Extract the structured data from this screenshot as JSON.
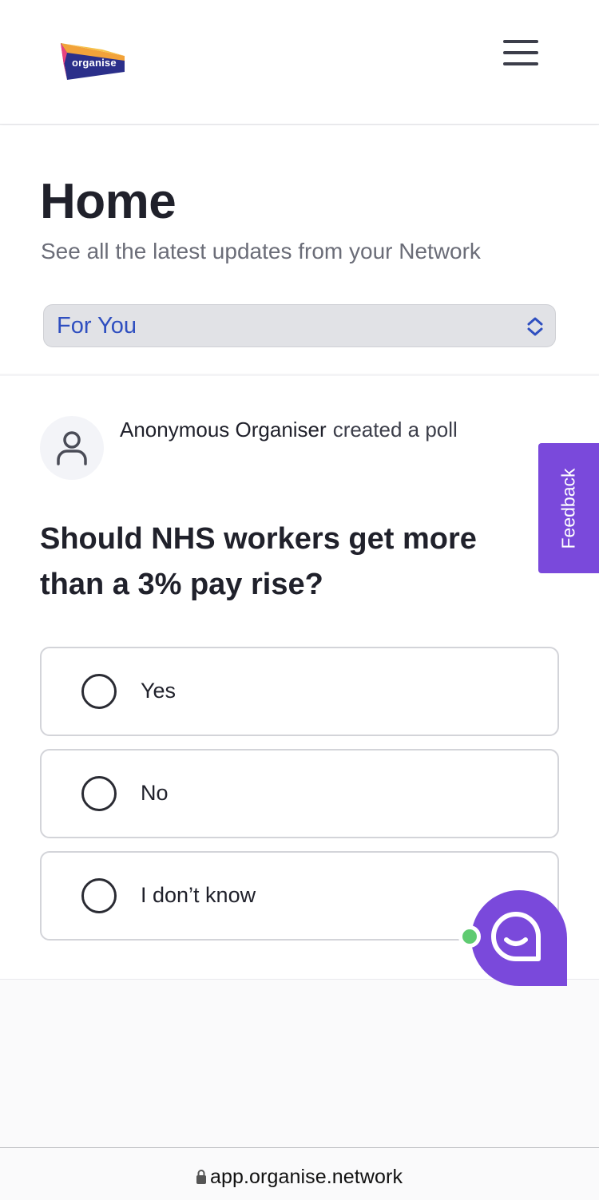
{
  "header": {
    "logo_text": "organise",
    "menu_icon": "hamburger-menu-icon"
  },
  "home": {
    "title": "Home",
    "subtitle": "See all the latest updates from your Network",
    "feed_select": {
      "value": "For You",
      "icon": "up-down-chevron-icon"
    }
  },
  "post": {
    "author": "Anonymous Organiser",
    "action": "created a poll",
    "avatar_icon": "user-icon",
    "question": "Should NHS workers get more than a 3% pay rise?",
    "options": [
      {
        "label": "Yes"
      },
      {
        "label": "No"
      },
      {
        "label": "I don’t know"
      }
    ]
  },
  "feedback_tab": {
    "label": "Feedback"
  },
  "chat": {
    "icon": "chat-smile-icon",
    "status": "online"
  },
  "browser": {
    "url": "app.organise.network",
    "lock_icon": "lock-icon"
  },
  "colors": {
    "accent_purple": "#7a49db",
    "link_blue": "#2f4fc0",
    "online_green": "#5fcb71",
    "text_dark": "#20212b"
  }
}
